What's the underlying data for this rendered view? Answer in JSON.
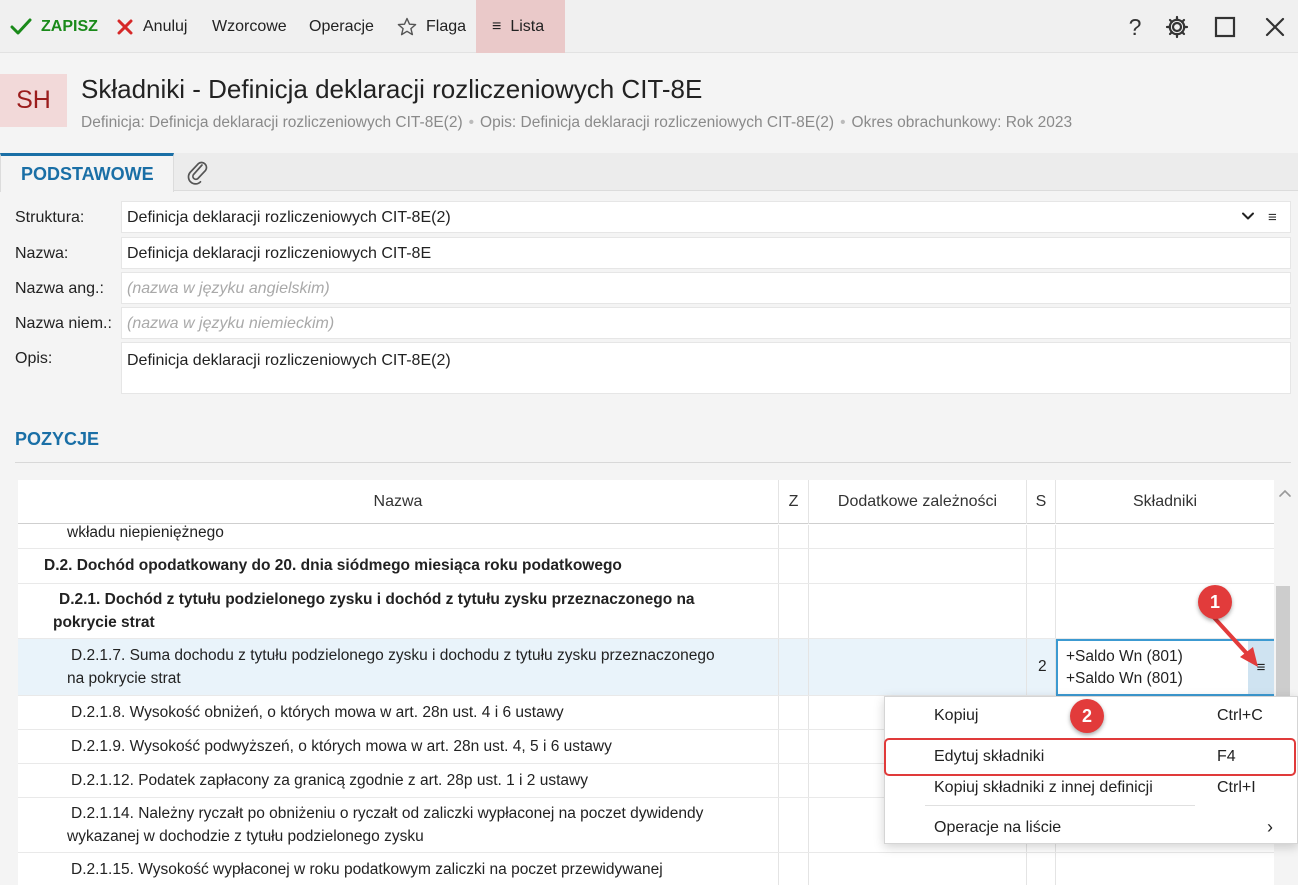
{
  "toolbar": {
    "save": "ZAPISZ",
    "cancel": "Anuluj",
    "templates": "Wzorcowe",
    "operations": "Operacje",
    "flag": "Flaga",
    "list": "Lista",
    "help": "?"
  },
  "header": {
    "logo": "SH",
    "title": "Składniki - Definicja deklaracji rozliczeniowych CIT-8E",
    "subtitle": {
      "definition": "Definicja: Definicja deklaracji rozliczeniowych CIT-8E(2)",
      "description": "Opis: Definicja deklaracji rozliczeniowych CIT-8E(2)",
      "period": "Okres obrachunkowy: Rok 2023",
      "separator": "•"
    }
  },
  "tabs": {
    "main": "PODSTAWOWE"
  },
  "form": {
    "struktura_label": "Struktura:",
    "struktura_value": "Definicja deklaracji rozliczeniowych CIT-8E(2)",
    "nazwa_label": "Nazwa:",
    "nazwa_value": "Definicja deklaracji rozliczeniowych CIT-8E",
    "nazwa_ang_label": "Nazwa ang.:",
    "nazwa_ang_placeholder": "(nazwa w języku angielskim)",
    "nazwa_niem_label": "Nazwa niem.:",
    "nazwa_niem_placeholder": "(nazwa w języku niemieckim)",
    "opis_label": "Opis:",
    "opis_value": "Definicja deklaracji rozliczeniowych CIT-8E(2)",
    "menu_glyph": "≡"
  },
  "section": {
    "title": "POZYCJE"
  },
  "table": {
    "columns": {
      "nazwa": "Nazwa",
      "z": "Z",
      "dodatkowe": "Dodatkowe zależności",
      "s": "S",
      "skladniki": "Składniki"
    },
    "rows": [
      {
        "line1": "wkładu niepieniężnego",
        "line2": ""
      },
      {
        "line1": "D.2. Dochód opodatkowany do 20. dnia siódmego miesiąca roku podatkowego",
        "line2": ""
      },
      {
        "line1": "D.2.1. Dochód z tytułu podzielonego zysku i dochód z tytułu zysku przeznaczonego na",
        "line2": "pokrycie strat"
      },
      {
        "line1": "D.2.1.7. Suma dochodu z tytułu podzielonego zysku i dochodu z tytułu zysku przeznaczonego",
        "line2": "na pokrycie strat",
        "s": "2",
        "skladniki": [
          "+Saldo Wn (801)",
          "+Saldo Wn (801)"
        ]
      },
      {
        "line1": "D.2.1.8. Wysokość obniżeń, o których mowa w art. 28n ust. 4 i 6 ustawy",
        "line2": ""
      },
      {
        "line1": "D.2.1.9. Wysokość podwyższeń, o których mowa w art. 28n ust. 4, 5 i 6 ustawy",
        "line2": ""
      },
      {
        "line1": "D.2.1.12. Podatek zapłacony za granicą zgodnie z art. 28p ust. 1 i 2 ustawy",
        "line2": ""
      },
      {
        "line1": "D.2.1.14. Należny ryczałt po obniżeniu o ryczałt od zaliczki wypłaconej na poczet dywidendy",
        "line2": "wykazanej w dochodzie z tytułu podzielonego zysku"
      },
      {
        "line1": "D.2.1.15. Wysokość wypłaconej w roku podatkowym zaliczki na poczet przewidywanej",
        "line2": ""
      }
    ]
  },
  "context_menu": {
    "items": [
      {
        "label": "Kopiuj",
        "shortcut": "Ctrl+C"
      },
      {
        "label": "Edytuj składniki",
        "shortcut": "F4"
      },
      {
        "label": "Kopiuj składniki z innej definicji",
        "shortcut": "Ctrl+I"
      },
      {
        "label": "Operacje na liście",
        "shortcut": ""
      }
    ],
    "submenu_arrow": "›"
  },
  "annotations": {
    "badge1": "1",
    "badge2": "2"
  },
  "colors": {
    "accent": "#1a6fa6",
    "save_green": "#1a8a1a",
    "cancel_red": "#d62828",
    "list_bg": "#eac9c9",
    "logo_fg": "#9b1c1c",
    "annotation_red": "#e23b3b",
    "selection_border": "#3c9ad1"
  }
}
